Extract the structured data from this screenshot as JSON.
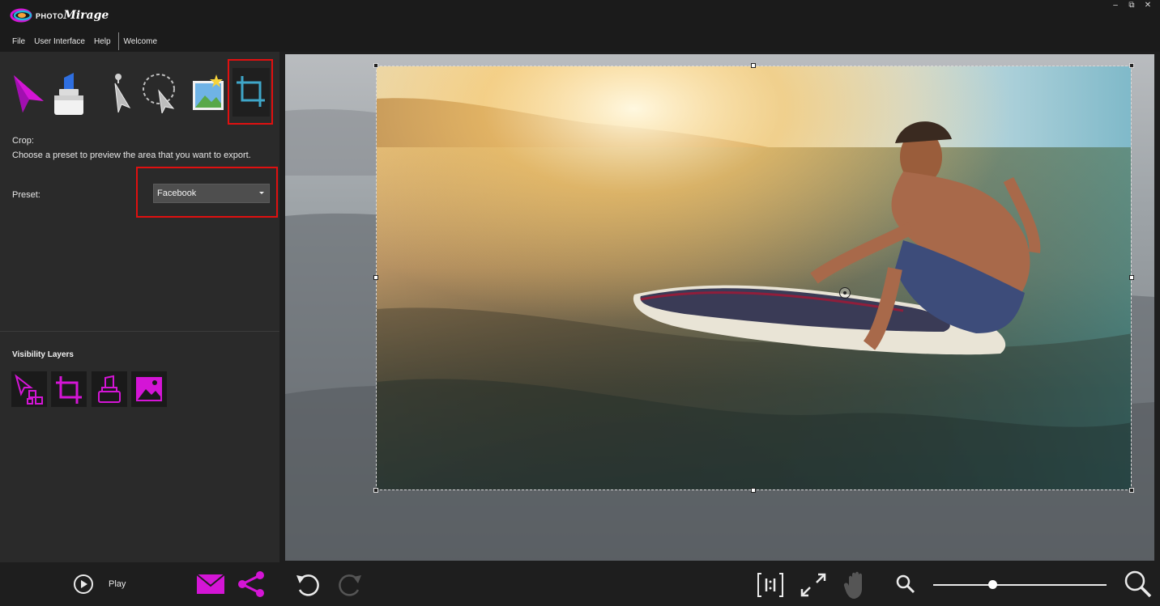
{
  "app": {
    "logo_small": "PHOTO",
    "logo_big": "Mirage",
    "controls": {
      "minimize": "–",
      "restore": "⧉",
      "close": "✕"
    }
  },
  "menu": {
    "items": [
      "File",
      "User Interface",
      "Help"
    ],
    "welcome": "Welcome"
  },
  "tools": [
    {
      "name": "motion-arrow-icon",
      "selected": false
    },
    {
      "name": "anchor-stabilizer-icon",
      "selected": false
    },
    {
      "name": "select-pointer-icon",
      "selected": false
    },
    {
      "name": "lasso-select-icon",
      "selected": false
    },
    {
      "name": "sky-overlay-icon",
      "selected": false
    },
    {
      "name": "crop-icon",
      "selected": true
    }
  ],
  "crop_panel": {
    "title": "Crop:",
    "description": "Choose a preset to preview the area that you want to export.",
    "preset_label": "Preset:",
    "preset_value": "Facebook"
  },
  "visibility": {
    "title": "Visibility Layers",
    "layers": [
      "motion-layer-icon",
      "crop-layer-icon",
      "mask-layer-icon",
      "image-layer-icon"
    ]
  },
  "bottom": {
    "play_label": "Play",
    "zoom_level": 0.34
  },
  "colors": {
    "accent": "#d415d6",
    "highlight": "#e01010",
    "panel": "#2a2a2a",
    "background": "#1e1e1e"
  }
}
